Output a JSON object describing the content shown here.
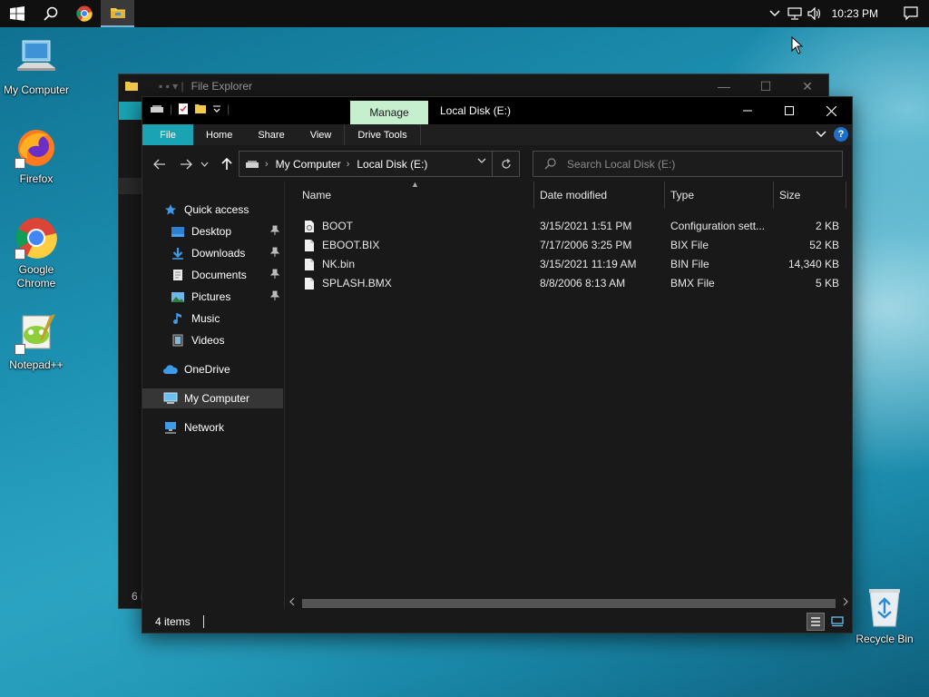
{
  "taskbar": {
    "clock": "10:23 PM"
  },
  "desktop_icons": [
    {
      "label": "My Computer"
    },
    {
      "label": "Firefox"
    },
    {
      "label": "Google Chrome"
    },
    {
      "label": "Notepad++"
    },
    {
      "label": "Recycle Bin"
    }
  ],
  "back_window": {
    "title": "File Explorer",
    "status": "6 i"
  },
  "window": {
    "title": "Local Disk (E:)",
    "context_tab": "Manage",
    "ribbon_tabs": [
      "File",
      "Home",
      "Share",
      "View",
      "Drive Tools"
    ],
    "address": {
      "segments": [
        "My Computer",
        "Local Disk (E:)"
      ]
    },
    "search_placeholder": "Search Local Disk (E:)",
    "nav": [
      {
        "label": "Quick access"
      },
      {
        "label": "Desktop"
      },
      {
        "label": "Downloads"
      },
      {
        "label": "Documents"
      },
      {
        "label": "Pictures"
      },
      {
        "label": "Music"
      },
      {
        "label": "Videos"
      },
      {
        "label": "OneDrive"
      },
      {
        "label": "My Computer"
      },
      {
        "label": "Network"
      }
    ],
    "columns": [
      "Name",
      "Date modified",
      "Type",
      "Size"
    ],
    "files": [
      {
        "name": "BOOT",
        "date": "3/15/2021 1:51 PM",
        "type": "Configuration sett...",
        "size": "2 KB"
      },
      {
        "name": "EBOOT.BIX",
        "date": "7/17/2006 3:25 PM",
        "type": "BIX File",
        "size": "52 KB"
      },
      {
        "name": "NK.bin",
        "date": "3/15/2021 11:19 AM",
        "type": "BIN File",
        "size": "14,340 KB"
      },
      {
        "name": "SPLASH.BMX",
        "date": "8/8/2006 8:13 AM",
        "type": "BMX File",
        "size": "5 KB"
      }
    ],
    "status": "4 items"
  }
}
